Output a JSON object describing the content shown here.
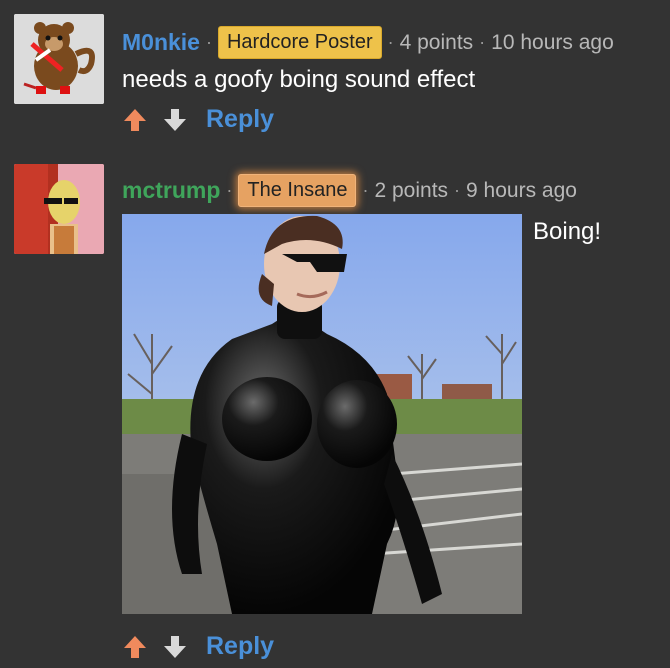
{
  "comments": [
    {
      "username": "M0nkie",
      "username_color": "#4a90d9",
      "badge": "Hardcore Poster",
      "points": "4 points",
      "time": "10 hours ago",
      "text": "needs a goofy boing sound effect",
      "reply_label": "Reply"
    },
    {
      "username": "mctrump",
      "username_color": "#3fa55b",
      "badge": "The Insane",
      "points": "2 points",
      "time": "9 hours ago",
      "text": "Boing!",
      "reply_label": "Reply"
    }
  ],
  "separator": "·",
  "colors": {
    "background": "#333333",
    "upvote": "#f08a5d",
    "downvote": "#d9d9d9",
    "reply": "#4a90d9",
    "badge_gold": "#eec24a",
    "badge_orange": "#e6a262"
  },
  "icons": {
    "upvote": "arrow-up-icon",
    "downvote": "arrow-down-icon"
  }
}
